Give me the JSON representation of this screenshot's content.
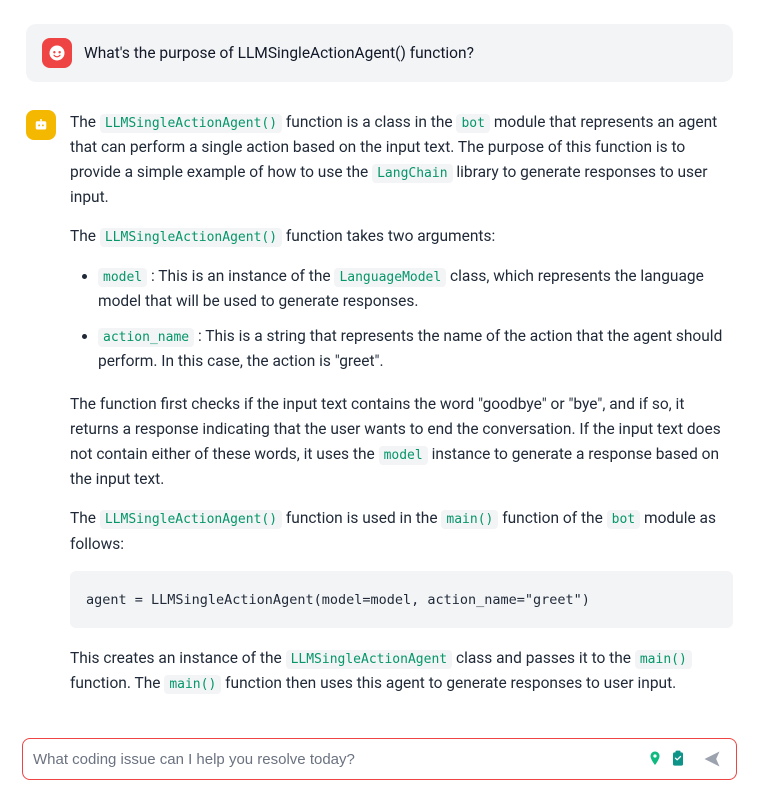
{
  "user": {
    "question": "What's the purpose of LLMSingleActionAgent() function?"
  },
  "assistant": {
    "p1_a": "The ",
    "code_llm": "LLMSingleActionAgent()",
    "p1_b": " function is a class in the ",
    "code_bot": "bot",
    "p1_c": " module that represents an agent that can perform a single action based on the input text. The purpose of this function is to provide a simple example of how to use the ",
    "code_langchain": "LangChain",
    "p1_d": " library to generate responses to user input.",
    "p2_a": "The ",
    "p2_b": " function takes two arguments:",
    "li1_code": "model",
    "li1_a": " : This is an instance of the ",
    "code_langmodel": "LanguageModel",
    "li1_b": " class, which represents the language model that will be used to generate responses.",
    "li2_code": "action_name",
    "li2_a": " : This is a string that represents the name of the action that the agent should perform. In this case, the action is \"greet\".",
    "p3_a": "The function first checks if the input text contains the word \"goodbye\" or \"bye\", and if so, it returns a response indicating that the user wants to end the conversation. If the input text does not contain either of these words, it uses the ",
    "code_model2": "model",
    "p3_b": " instance to generate a response based on the input text.",
    "p4_a": "The ",
    "p4_b": " function is used in the ",
    "code_main": "main()",
    "p4_c": " function of the ",
    "p4_d": " module as follows:",
    "codeblock": "agent = LLMSingleActionAgent(model=model, action_name=\"greet\")",
    "p5_a": "This creates an instance of the ",
    "code_llm2": "LLMSingleActionAgent",
    "p5_b": " class and passes it to the ",
    "p5_c": " function. The ",
    "p5_d": " function then uses this agent to generate responses to user input."
  },
  "input": {
    "placeholder": "What coding issue can I help you resolve today?"
  }
}
